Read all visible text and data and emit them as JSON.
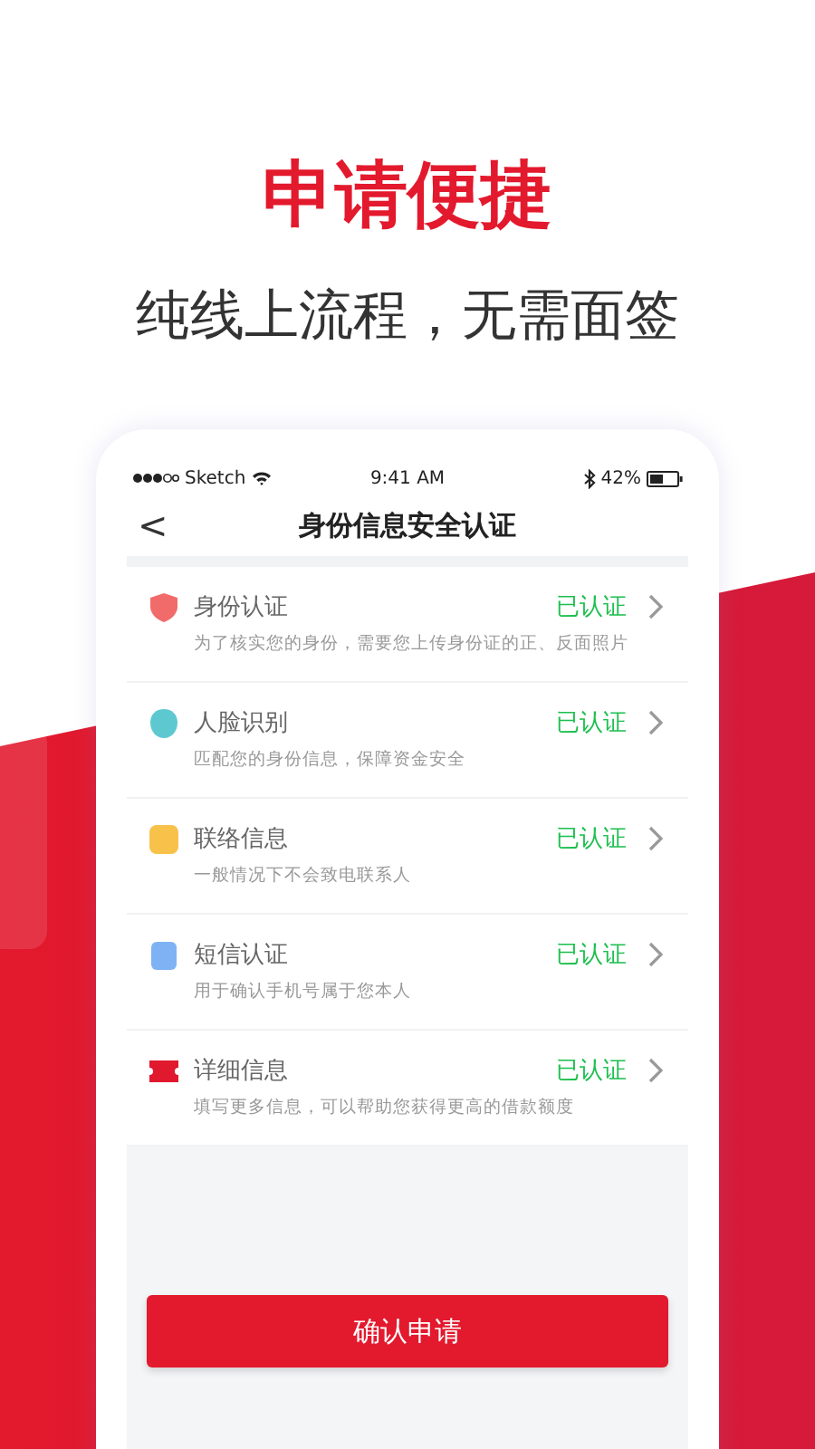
{
  "headline": "申请便捷",
  "subtitle": "纯线上流程，无需面签",
  "status_bar": {
    "carrier": "Sketch",
    "time": "9:41 AM",
    "battery": "42%"
  },
  "nav": {
    "back": "<",
    "title": "身份信息安全认证"
  },
  "items": [
    {
      "kind": "shield",
      "color": "#f26b6b",
      "title": "身份认证",
      "description": "为了核实您的身份，需要您上传身份证的正、反面照片",
      "status": "已认证"
    },
    {
      "kind": "face",
      "color": "#5ec8d0",
      "title": "人脸识别",
      "description": "匹配您的身份信息，保障资金安全",
      "status": "已认证"
    },
    {
      "kind": "phone",
      "color": "#f8c24a",
      "title": "联络信息",
      "description": "一般情况下不会致电联系人",
      "status": "已认证"
    },
    {
      "kind": "sms",
      "color": "#7fb2f5",
      "title": "短信认证",
      "description": "用于确认手机号属于您本人",
      "status": "已认证"
    },
    {
      "kind": "ticket",
      "color": "#e0192e",
      "title": "详细信息",
      "description": "填写更多信息，可以帮助您获得更高的借款额度",
      "status": "已认证"
    }
  ],
  "confirm_button": "确认申请"
}
